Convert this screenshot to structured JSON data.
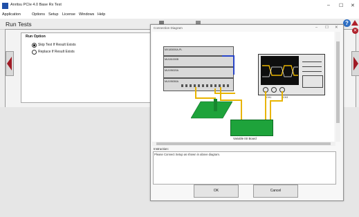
{
  "window": {
    "title": "Anritsu PCIe 4.0 Base Rx Test",
    "min": "–",
    "max": "☐",
    "close": "✕"
  },
  "menu": [
    "Application",
    "Options",
    "Setup",
    "License",
    "Windows",
    "Help"
  ],
  "header": {
    "title": "Run Tests",
    "help": "?"
  },
  "run_option": {
    "title": "Run Option",
    "options": [
      {
        "label": "Skip Test If Result Exists",
        "selected": true
      },
      {
        "label": "Replace If Result Exists",
        "selected": false
      }
    ]
  },
  "dialog": {
    "title": "Connection Diagram",
    "min": "–",
    "max": "☐",
    "close": "✕",
    "instruments": [
      "MX183000A-PL",
      "MU181000B",
      "MU195020A",
      "MU195050A"
    ],
    "scope_channels": [
      "CH1",
      "CH3"
    ],
    "board_label": "Variable ISI Board",
    "instruction_label": "Instruction:",
    "instruction_text": "Please Connect Setup as shown in above diagram.",
    "ok": "OK",
    "cancel": "Cancel"
  },
  "colors": {
    "accent_red": "#b0202a",
    "board_green": "#1ea33b",
    "wire_yellow": "#e8b400"
  }
}
